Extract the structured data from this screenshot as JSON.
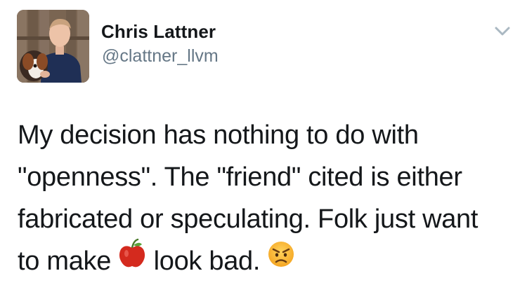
{
  "tweet": {
    "author": {
      "name": "Chris Lattner",
      "handle": "@clattner_llvm",
      "avatar_icon": "profile-photo-man-with-dog"
    },
    "menu_icon": "chevron-down-icon",
    "text": {
      "line1": "My decision has nothing to do with",
      "line2": "\"openness\". The \"friend\" cited is either",
      "line3": "fabricated or speculating. Folk just want",
      "line4_before": "to make",
      "line4_after": "look bad.",
      "emoji_apple": "red-apple-emoji",
      "emoji_face": "angry-face-emoji"
    },
    "colors": {
      "name": "#14171a",
      "handle": "#657786",
      "chevron": "#aab8c2"
    }
  }
}
